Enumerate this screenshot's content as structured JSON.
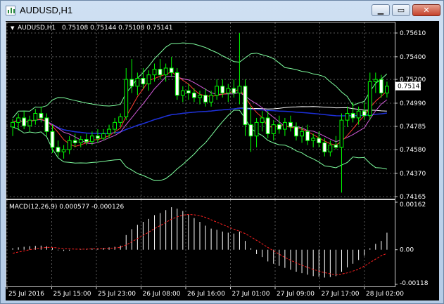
{
  "window": {
    "title": "AUDUSD,H1",
    "buttons": {
      "minimize": "▁",
      "maximize": "▭",
      "close": "✕"
    }
  },
  "colors": {
    "background": "#000000",
    "grid": "#5a5a5a",
    "axis_text": "#ffffff",
    "bull_candle": "#000000",
    "bull_outline": "#00ff00",
    "bear_candle": "#ffffff",
    "ma_white": "#ffffff",
    "ma_blue": "#1c2fd9",
    "ma_red": "#ff3b2f",
    "ma_violet": "#d25bd9",
    "bollinger": "#7fff9f",
    "macd_hist": "#ffffff",
    "macd_signal": "#ff2020",
    "price_marker_bg": "#ffffff"
  },
  "main_panel": {
    "symbol_label": "AUDUSD,H1",
    "ohlc": "0.75108 0.75144 0.75108 0.75141",
    "price_ticks": [
      "0.75610",
      "0.75400",
      "0.75200",
      "0.74990",
      "0.74785",
      "0.74580",
      "0.74370",
      "0.74165"
    ],
    "current_price": "0.75141"
  },
  "macd_panel": {
    "label": "MACD(12,26,9) 0.000577 -0.000126",
    "ticks": [
      "0.00162",
      "0.00",
      "-0.00118"
    ]
  },
  "time_axis": [
    "25 Jul 2016",
    "25 Jul 15:00",
    "25 Jul 23:00",
    "26 Jul 08:00",
    "26 Jul 16:00",
    "27 Jul 01:00",
    "27 Jul 09:00",
    "27 Jul 17:00",
    "28 Jul 02:00"
  ],
  "chart_data": {
    "type": "candlestick",
    "symbol": "AUDUSD",
    "timeframe": "H1",
    "ylim": [
      0.74165,
      0.7561
    ],
    "candles": [
      {
        "o": 0.7478,
        "h": 0.7485,
        "l": 0.747,
        "c": 0.7482
      },
      {
        "o": 0.7482,
        "h": 0.749,
        "l": 0.7475,
        "c": 0.7486
      },
      {
        "o": 0.7486,
        "h": 0.7492,
        "l": 0.7476,
        "c": 0.7479
      },
      {
        "o": 0.7479,
        "h": 0.7488,
        "l": 0.7474,
        "c": 0.7484
      },
      {
        "o": 0.7484,
        "h": 0.7494,
        "l": 0.748,
        "c": 0.749
      },
      {
        "o": 0.749,
        "h": 0.7496,
        "l": 0.7482,
        "c": 0.7486
      },
      {
        "o": 0.7486,
        "h": 0.749,
        "l": 0.747,
        "c": 0.7474
      },
      {
        "o": 0.7474,
        "h": 0.748,
        "l": 0.7455,
        "c": 0.746
      },
      {
        "o": 0.746,
        "h": 0.7466,
        "l": 0.7452,
        "c": 0.7456
      },
      {
        "o": 0.7456,
        "h": 0.7462,
        "l": 0.745,
        "c": 0.7458
      },
      {
        "o": 0.7458,
        "h": 0.747,
        "l": 0.7454,
        "c": 0.7466
      },
      {
        "o": 0.7466,
        "h": 0.7472,
        "l": 0.746,
        "c": 0.7464
      },
      {
        "o": 0.7464,
        "h": 0.747,
        "l": 0.746,
        "c": 0.7467
      },
      {
        "o": 0.7467,
        "h": 0.7472,
        "l": 0.7462,
        "c": 0.7465
      },
      {
        "o": 0.7465,
        "h": 0.7474,
        "l": 0.7462,
        "c": 0.747
      },
      {
        "o": 0.747,
        "h": 0.7476,
        "l": 0.7464,
        "c": 0.7468
      },
      {
        "o": 0.7468,
        "h": 0.7476,
        "l": 0.7466,
        "c": 0.7472
      },
      {
        "o": 0.7472,
        "h": 0.748,
        "l": 0.7468,
        "c": 0.7476
      },
      {
        "o": 0.7476,
        "h": 0.7486,
        "l": 0.7472,
        "c": 0.7482
      },
      {
        "o": 0.7482,
        "h": 0.749,
        "l": 0.7478,
        "c": 0.7487
      },
      {
        "o": 0.7487,
        "h": 0.753,
        "l": 0.7484,
        "c": 0.752
      },
      {
        "o": 0.752,
        "h": 0.7538,
        "l": 0.7508,
        "c": 0.7514
      },
      {
        "o": 0.7514,
        "h": 0.7526,
        "l": 0.7506,
        "c": 0.7521
      },
      {
        "o": 0.7521,
        "h": 0.753,
        "l": 0.7512,
        "c": 0.7516
      },
      {
        "o": 0.7516,
        "h": 0.7528,
        "l": 0.751,
        "c": 0.7524
      },
      {
        "o": 0.7524,
        "h": 0.7534,
        "l": 0.7518,
        "c": 0.7529
      },
      {
        "o": 0.7529,
        "h": 0.7538,
        "l": 0.752,
        "c": 0.7524
      },
      {
        "o": 0.7524,
        "h": 0.7534,
        "l": 0.7518,
        "c": 0.753
      },
      {
        "o": 0.753,
        "h": 0.754,
        "l": 0.7522,
        "c": 0.7526
      },
      {
        "o": 0.7526,
        "h": 0.753,
        "l": 0.7502,
        "c": 0.7506
      },
      {
        "o": 0.7506,
        "h": 0.7514,
        "l": 0.75,
        "c": 0.751
      },
      {
        "o": 0.751,
        "h": 0.7516,
        "l": 0.7502,
        "c": 0.7508
      },
      {
        "o": 0.7508,
        "h": 0.7512,
        "l": 0.75,
        "c": 0.7504
      },
      {
        "o": 0.7504,
        "h": 0.751,
        "l": 0.7498,
        "c": 0.7506
      },
      {
        "o": 0.7506,
        "h": 0.7512,
        "l": 0.7496,
        "c": 0.75
      },
      {
        "o": 0.75,
        "h": 0.751,
        "l": 0.7496,
        "c": 0.7506
      },
      {
        "o": 0.7506,
        "h": 0.752,
        "l": 0.7502,
        "c": 0.7514
      },
      {
        "o": 0.7514,
        "h": 0.752,
        "l": 0.7504,
        "c": 0.7508
      },
      {
        "o": 0.7508,
        "h": 0.7516,
        "l": 0.75,
        "c": 0.7512
      },
      {
        "o": 0.7512,
        "h": 0.752,
        "l": 0.7504,
        "c": 0.7508
      },
      {
        "o": 0.7508,
        "h": 0.7561,
        "l": 0.7498,
        "c": 0.7514
      },
      {
        "o": 0.7514,
        "h": 0.752,
        "l": 0.747,
        "c": 0.748
      },
      {
        "o": 0.748,
        "h": 0.7496,
        "l": 0.7456,
        "c": 0.747
      },
      {
        "o": 0.747,
        "h": 0.7486,
        "l": 0.746,
        "c": 0.7482
      },
      {
        "o": 0.7482,
        "h": 0.7492,
        "l": 0.7474,
        "c": 0.7486
      },
      {
        "o": 0.7486,
        "h": 0.7492,
        "l": 0.7468,
        "c": 0.7472
      },
      {
        "o": 0.7472,
        "h": 0.7484,
        "l": 0.7466,
        "c": 0.748
      },
      {
        "o": 0.748,
        "h": 0.7488,
        "l": 0.7472,
        "c": 0.7476
      },
      {
        "o": 0.7476,
        "h": 0.7486,
        "l": 0.747,
        "c": 0.7482
      },
      {
        "o": 0.7482,
        "h": 0.7488,
        "l": 0.7474,
        "c": 0.7478
      },
      {
        "o": 0.7478,
        "h": 0.7482,
        "l": 0.7466,
        "c": 0.747
      },
      {
        "o": 0.747,
        "h": 0.7478,
        "l": 0.7464,
        "c": 0.7474
      },
      {
        "o": 0.7474,
        "h": 0.748,
        "l": 0.7462,
        "c": 0.7466
      },
      {
        "o": 0.7466,
        "h": 0.7472,
        "l": 0.746,
        "c": 0.7468
      },
      {
        "o": 0.7468,
        "h": 0.7474,
        "l": 0.746,
        "c": 0.7464
      },
      {
        "o": 0.7464,
        "h": 0.7468,
        "l": 0.7452,
        "c": 0.7456
      },
      {
        "o": 0.7456,
        "h": 0.7466,
        "l": 0.7452,
        "c": 0.7462
      },
      {
        "o": 0.7462,
        "h": 0.747,
        "l": 0.7458,
        "c": 0.746
      },
      {
        "o": 0.746,
        "h": 0.749,
        "l": 0.742,
        "c": 0.7484
      },
      {
        "o": 0.7484,
        "h": 0.7496,
        "l": 0.7478,
        "c": 0.749
      },
      {
        "o": 0.749,
        "h": 0.75,
        "l": 0.7482,
        "c": 0.7486
      },
      {
        "o": 0.7486,
        "h": 0.7496,
        "l": 0.748,
        "c": 0.7492
      },
      {
        "o": 0.7492,
        "h": 0.75,
        "l": 0.7484,
        "c": 0.7488
      },
      {
        "o": 0.7488,
        "h": 0.7526,
        "l": 0.7484,
        "c": 0.7518
      },
      {
        "o": 0.7518,
        "h": 0.7526,
        "l": 0.7508,
        "c": 0.752
      },
      {
        "o": 0.752,
        "h": 0.7524,
        "l": 0.7504,
        "c": 0.7508
      },
      {
        "o": 0.7508,
        "h": 0.7518,
        "l": 0.7504,
        "c": 0.7514
      }
    ],
    "macd_hist": [
      5e-05,
      8e-05,
      0.0001,
      0.00012,
      0.00013,
      0.00014,
      0.00012,
      6e-05,
      -2e-05,
      -4e-05,
      -3e-05,
      0.0,
      2e-05,
      3e-05,
      4e-05,
      5e-05,
      6e-05,
      8e-05,
      0.0001,
      0.00014,
      0.0005,
      0.0007,
      0.00085,
      0.00095,
      0.00105,
      0.00118,
      0.00125,
      0.00135,
      0.00145,
      0.0014,
      0.00132,
      0.0012,
      0.00108,
      0.00095,
      0.00082,
      0.00072,
      0.00068,
      0.00062,
      0.00058,
      0.00055,
      0.00062,
      0.0003,
      5e-05,
      -0.00015,
      -0.00025,
      -0.0004,
      -0.00048,
      -0.00055,
      -0.00062,
      -0.00068,
      -0.00075,
      -0.0008,
      -0.00085,
      -0.0009,
      -0.00092,
      -0.00095,
      -0.00093,
      -0.0009,
      -0.00075,
      -0.0006,
      -0.00048,
      -0.00035,
      -0.0002,
      5e-05,
      0.0002,
      0.0003,
      0.00058
    ],
    "macd_signal": [
      -0.00012,
      -8e-05,
      -4e-05,
      0.0,
      3e-05,
      6e-05,
      8e-05,
      8e-05,
      6e-05,
      4e-05,
      3e-05,
      2e-05,
      2e-05,
      2e-05,
      3e-05,
      3e-05,
      4e-05,
      5e-05,
      6e-05,
      8e-05,
      0.00016,
      0.00027,
      0.00038,
      0.00049,
      0.0006,
      0.00072,
      0.00082,
      0.00093,
      0.00104,
      0.00112,
      0.00118,
      0.0012,
      0.00119,
      0.00116,
      0.0011,
      0.00102,
      0.00094,
      0.00086,
      0.00078,
      0.0007,
      0.00063,
      0.00055,
      0.00044,
      0.00032,
      0.0002,
      8e-05,
      -4e-05,
      -0.00015,
      -0.00026,
      -0.00036,
      -0.00045,
      -0.00053,
      -0.0006,
      -0.00067,
      -0.00073,
      -0.00078,
      -0.00082,
      -0.00085,
      -0.00083,
      -0.00079,
      -0.00073,
      -0.00066,
      -0.00056,
      -0.00044,
      -0.00032,
      -0.0002,
      -0.00013
    ],
    "macd_ylim": [
      -0.00118,
      0.00162
    ]
  }
}
